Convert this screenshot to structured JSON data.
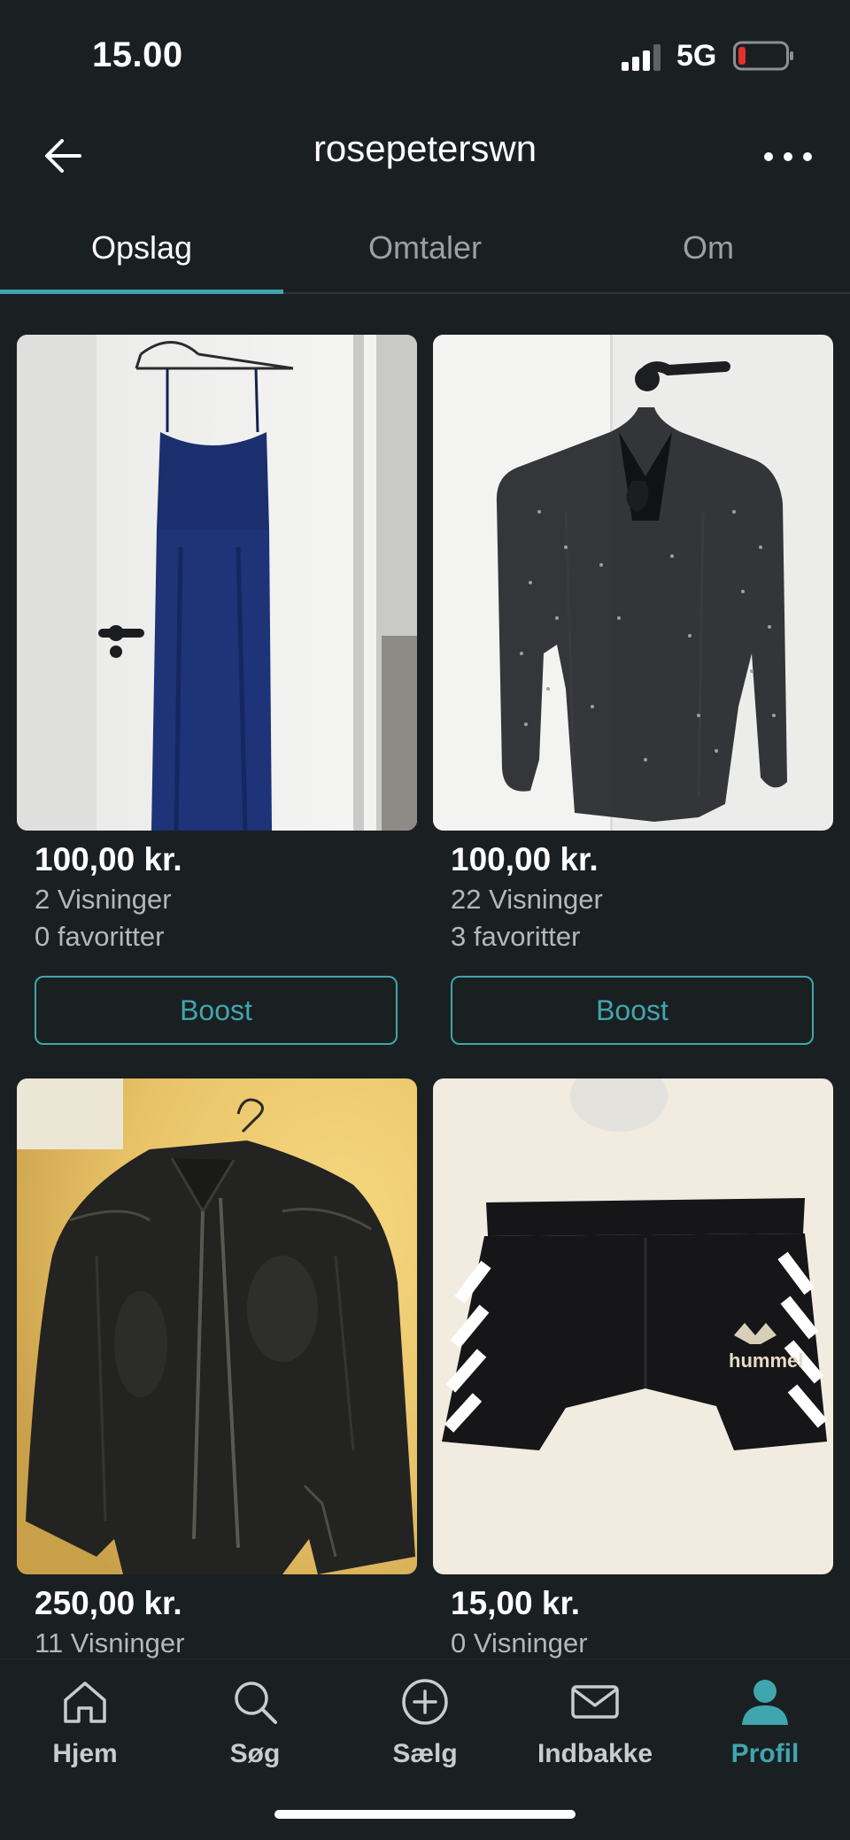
{
  "status_bar": {
    "time": "15.00",
    "network": "5G"
  },
  "header": {
    "title": "rosepeterswn"
  },
  "tabs": [
    {
      "label": "Opslag"
    },
    {
      "label": "Omtaler"
    },
    {
      "label": "Om"
    }
  ],
  "listings": [
    {
      "image": "navy-maxi-dress",
      "price": "100,00 kr.",
      "views": "2 Visninger",
      "favorites": "0 favoritter",
      "boost_label": "Boost"
    },
    {
      "image": "black-sheer-polka-dot-blouse",
      "price": "100,00 kr.",
      "views": "22 Visninger",
      "favorites": "3 favoritter",
      "boost_label": "Boost"
    },
    {
      "image": "black-leather-jacket",
      "price": "250,00 kr.",
      "views": "11 Visninger"
    },
    {
      "image": "black-hummel-shorts",
      "price": "15,00 kr.",
      "views": "0 Visninger",
      "brand_mark": "hummel"
    }
  ],
  "bottom_nav": [
    {
      "label": "Hjem",
      "icon": "home-icon"
    },
    {
      "label": "Søg",
      "icon": "search-icon"
    },
    {
      "label": "Sælg",
      "icon": "plus-circle-icon"
    },
    {
      "label": "Indbakke",
      "icon": "mail-icon"
    },
    {
      "label": "Profil",
      "icon": "profile-icon"
    }
  ],
  "colors": {
    "background": "#1a1f22",
    "accent": "#3fa6ad",
    "battery_low": "#e5302b"
  }
}
